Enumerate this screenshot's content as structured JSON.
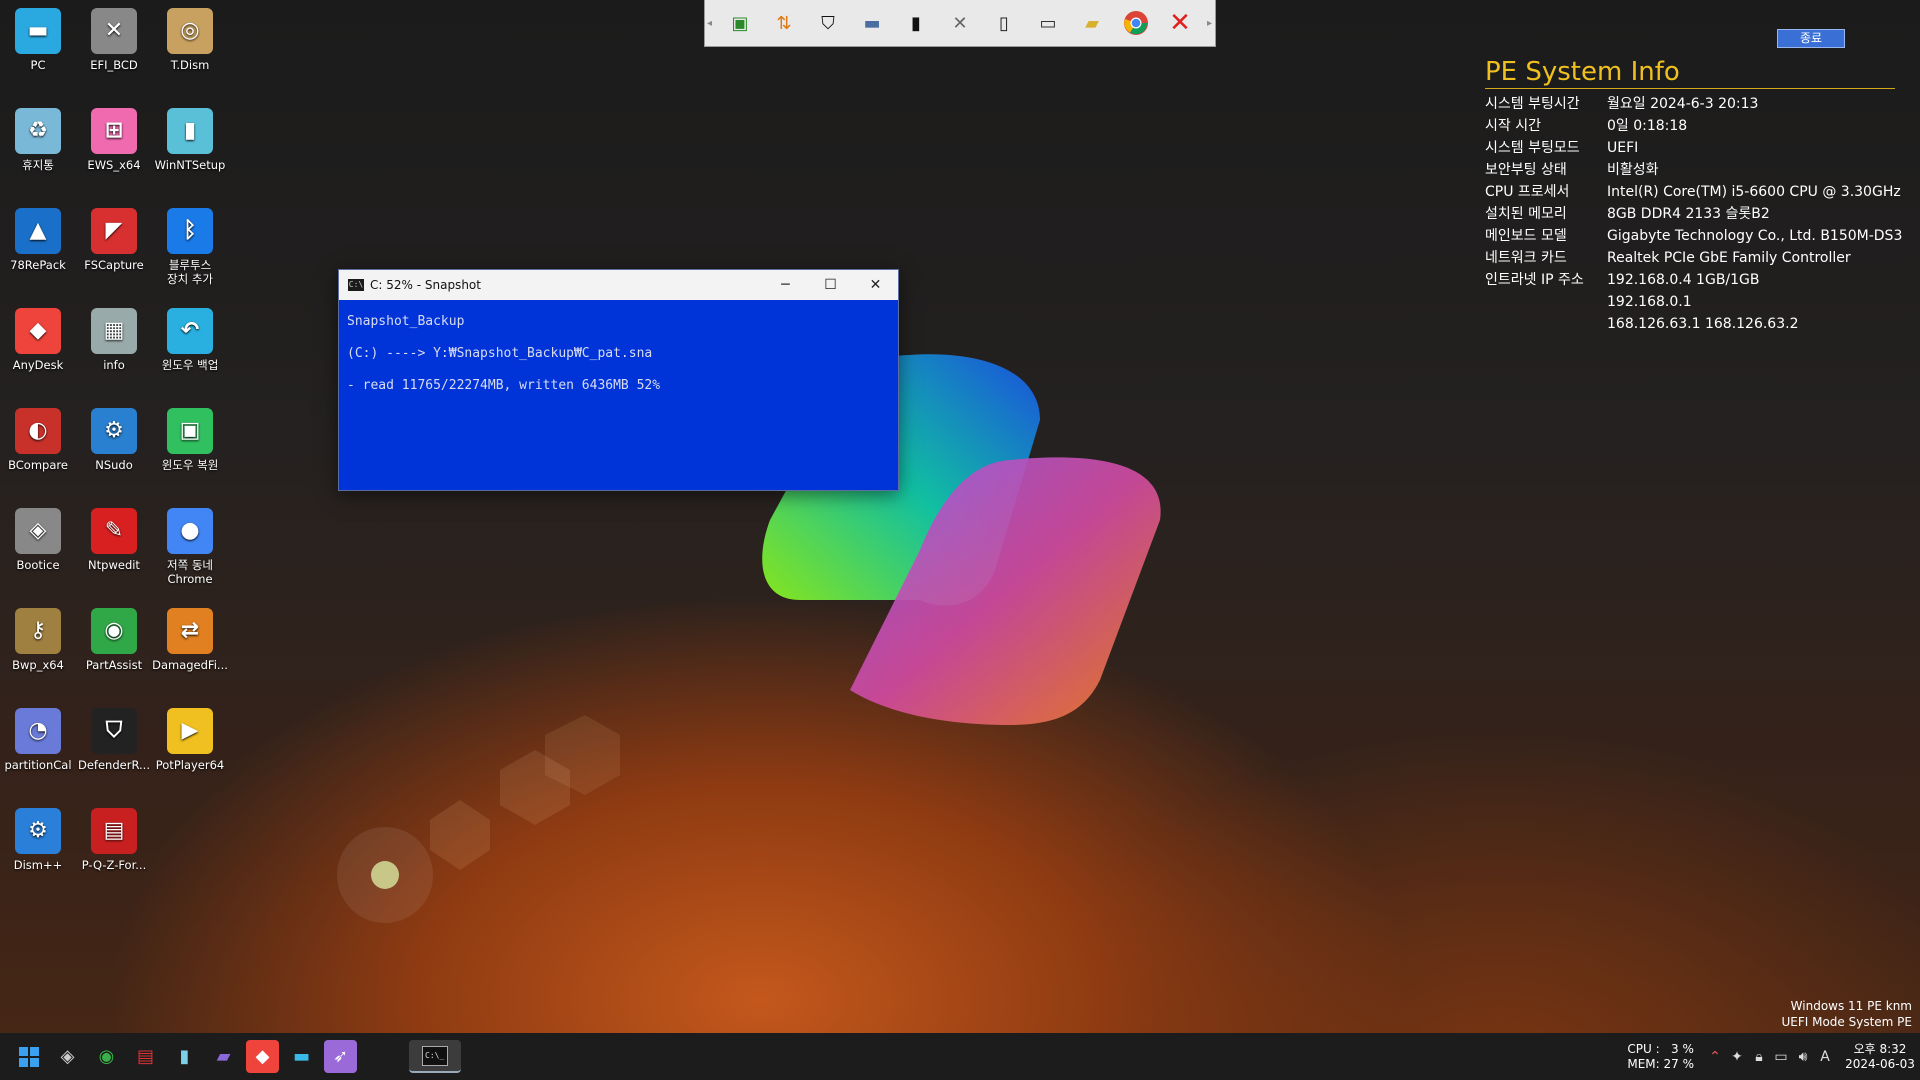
{
  "desktop": {
    "icons": [
      {
        "label": "PC",
        "icon": "pc-icon"
      },
      {
        "label": "EFI_BCD",
        "icon": "tools-icon"
      },
      {
        "label": "T.Dism",
        "icon": "disc-box-icon"
      },
      {
        "label": "휴지통",
        "icon": "recycle-bin-icon"
      },
      {
        "label": "EWS_x64",
        "icon": "windows-pink-icon"
      },
      {
        "label": "WinNTSetup",
        "icon": "setup-icon"
      },
      {
        "label": "78RePack",
        "icon": "triangle-icon"
      },
      {
        "label": "FSCapture",
        "icon": "capture-icon"
      },
      {
        "label": "블루투스\n장치 추가",
        "icon": "bluetooth-icon"
      },
      {
        "label": "AnyDesk",
        "icon": "anydesk-icon"
      },
      {
        "label": "info",
        "icon": "info-icon"
      },
      {
        "label": "윈도우 백업",
        "icon": "windows-backup-icon"
      },
      {
        "label": "BCompare",
        "icon": "bcompare-icon"
      },
      {
        "label": "NSudo",
        "icon": "nsudo-icon"
      },
      {
        "label": "윈도우 복원",
        "icon": "windows-restore-icon"
      },
      {
        "label": "Bootice",
        "icon": "bootice-icon"
      },
      {
        "label": "Ntpwedit",
        "icon": "ntpwedit-icon"
      },
      {
        "label": "저쪽 동네\nChrome",
        "icon": "chrome-icon"
      },
      {
        "label": "Bwp_x64",
        "icon": "key-icon"
      },
      {
        "label": "PartAssist",
        "icon": "partassist-icon"
      },
      {
        "label": "DamagedFi...",
        "icon": "damaged-files-icon"
      },
      {
        "label": "partitionCal",
        "icon": "pie-icon"
      },
      {
        "label": "DefenderR...",
        "icon": "shield-icon"
      },
      {
        "label": "PotPlayer64",
        "icon": "play-icon"
      },
      {
        "label": "Dism++",
        "icon": "gear-icon"
      },
      {
        "label": "P-Q-Z-For...",
        "icon": "drive-format-icon"
      }
    ]
  },
  "toolbar": {
    "buttons": [
      "network-card-icon",
      "transfer-icon",
      "shield-icon",
      "drive-icon",
      "cmd-icon",
      "tools-icon",
      "sd-card-icon",
      "monitor-icon",
      "folder-add-icon",
      "chrome-icon",
      "close-icon"
    ]
  },
  "exit_button": {
    "label": "종료"
  },
  "sysinfo": {
    "title": "PE System Info",
    "rows": [
      {
        "k": "시스템 부팅시간",
        "v": "월요일 2024-6-3 20:13"
      },
      {
        "k": "시작 시간",
        "v": "0일 0:18:18"
      },
      {
        "k": "시스템 부팅모드",
        "v": "UEFI"
      },
      {
        "k": "보안부팅 상태",
        "v": "비활성화"
      },
      {
        "k": "CPU 프로세서",
        "v": "Intel(R) Core(TM) i5-6600 CPU @ 3.30GHz"
      },
      {
        "k": "설치된 메모리",
        "v": "8GB DDR4 2133 슬롯B2"
      },
      {
        "k": "메인보드 모델",
        "v": "Gigabyte Technology Co., Ltd. B150M-DS3"
      },
      {
        "k": "네트워크 카드",
        "v": "Realtek PCIe GbE Family Controller"
      },
      {
        "k": "인트라넷 IP 주소",
        "v": "192.168.0.4   1GB/1GB"
      },
      {
        "k": "",
        "v": "192.168.0.1"
      },
      {
        "k": "",
        "v": "168.126.63.1  168.126.63.2"
      }
    ]
  },
  "window": {
    "title": "C: 52% - Snapshot",
    "lines": [
      "Snapshot_Backup",
      "(C:) ----> Y:₩Snapshot_Backup₩C_pat.sna",
      "",
      "- read 11765/22274MB, written 6436MB 52%"
    ]
  },
  "watermark": {
    "line1": "Windows 11 PE knm",
    "line2": "UEFI Mode System PE"
  },
  "taskbar": {
    "items": [
      "start-icon",
      "bootice-icon",
      "partassist-icon",
      "drive-format-icon",
      "setup-icon",
      "media-icon",
      "anydesk-icon",
      "pc-icon",
      "rocket-icon"
    ],
    "active": "cmd-icon"
  },
  "tray": {
    "cpu": "CPU :   3 %",
    "mem": "MEM: 27 %",
    "icons": [
      "chart-icon",
      "network-icon",
      "lock-icon",
      "display-icon",
      "volume-icon",
      "ime-icon"
    ],
    "ime": "A",
    "time": "오후 8:32",
    "date": "2024-06-03"
  },
  "colors": {
    "console_bg": "#0033d8",
    "info_title": "#f0c020",
    "taskbar": "#1c1c1c"
  }
}
